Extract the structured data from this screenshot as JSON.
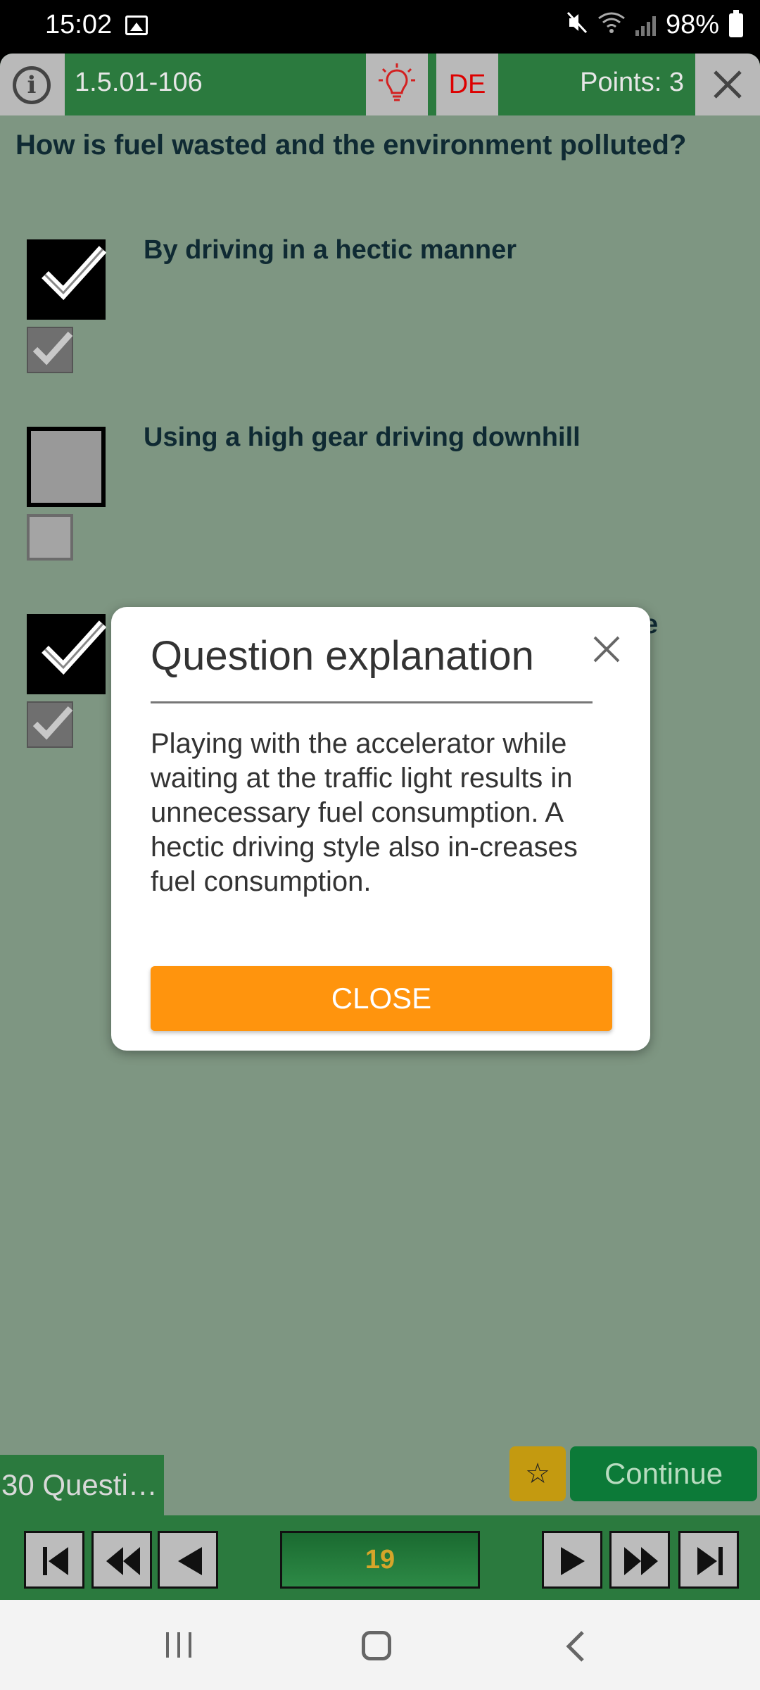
{
  "status_bar": {
    "time": "15:02",
    "battery": "98%",
    "icons": [
      "image-icon",
      "mute-icon",
      "wifi-icon",
      "signal-icon",
      "battery-icon"
    ]
  },
  "topbar": {
    "question_id": "1.5.01-106",
    "language": "DE",
    "points": "Points: 3",
    "icons": [
      "info-icon",
      "lightbulb-icon",
      "close-icon"
    ]
  },
  "question": {
    "text": "How is fuel wasted and the environment polluted?"
  },
  "answers": [
    {
      "text": "By driving in a hectic manner",
      "checked": true
    },
    {
      "text": "Using a high gear driving downhill",
      "checked": false
    },
    {
      "text": "e",
      "checked": true
    }
  ],
  "bottom": {
    "question_count": "30 Questi…",
    "star_label": "☆",
    "continue_label": "Continue",
    "page": "19",
    "nav_icons": [
      "first-icon",
      "rewind-icon",
      "previous-icon",
      "next-icon",
      "fast-forward-icon",
      "last-icon"
    ]
  },
  "dialog": {
    "title": "Question explanation",
    "body": "Playing with the accelerator while waiting at the traffic light results in unnecessary fuel consumption. A hectic driving style also in-creases fuel consumption.",
    "button_label": "CLOSE"
  },
  "colors": {
    "background": "#7e9682",
    "bar_green": "#2b7a3e",
    "accent_orange": "#ff940d",
    "continue_green": "#0c7a38",
    "star_gold": "#c49a10"
  }
}
